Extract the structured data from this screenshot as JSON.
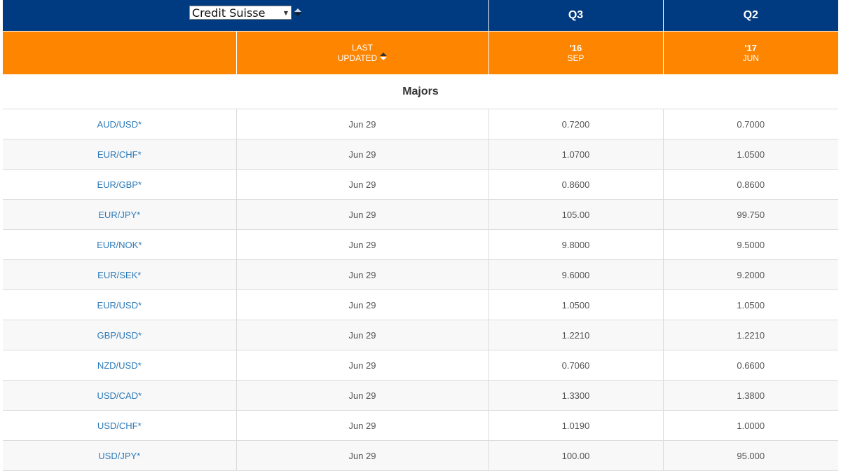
{
  "provider": {
    "selected": "Credit Suisse"
  },
  "columns": {
    "q3": "Q3",
    "q2": "Q2",
    "last_updated_line1": "LAST",
    "last_updated_line2": "UPDATED",
    "q3_year": "'16",
    "q3_month": "SEP",
    "q2_year": "'17",
    "q2_month": "JUN"
  },
  "section": {
    "title": "Majors"
  },
  "rows": [
    {
      "pair": "AUD/USD*",
      "updated": "Jun 29",
      "q3": "0.7200",
      "q2": "0.7000"
    },
    {
      "pair": "EUR/CHF*",
      "updated": "Jun 29",
      "q3": "1.0700",
      "q2": "1.0500"
    },
    {
      "pair": "EUR/GBP*",
      "updated": "Jun 29",
      "q3": "0.8600",
      "q2": "0.8600"
    },
    {
      "pair": "EUR/JPY*",
      "updated": "Jun 29",
      "q3": "105.00",
      "q2": "99.750"
    },
    {
      "pair": "EUR/NOK*",
      "updated": "Jun 29",
      "q3": "9.8000",
      "q2": "9.5000"
    },
    {
      "pair": "EUR/SEK*",
      "updated": "Jun 29",
      "q3": "9.6000",
      "q2": "9.2000"
    },
    {
      "pair": "EUR/USD*",
      "updated": "Jun 29",
      "q3": "1.0500",
      "q2": "1.0500"
    },
    {
      "pair": "GBP/USD*",
      "updated": "Jun 29",
      "q3": "1.2210",
      "q2": "1.2210"
    },
    {
      "pair": "NZD/USD*",
      "updated": "Jun 29",
      "q3": "0.7060",
      "q2": "0.6600"
    },
    {
      "pair": "USD/CAD*",
      "updated": "Jun 29",
      "q3": "1.3300",
      "q2": "1.3800"
    },
    {
      "pair": "USD/CHF*",
      "updated": "Jun 29",
      "q3": "1.0190",
      "q2": "1.0000"
    },
    {
      "pair": "USD/JPY*",
      "updated": "Jun 29",
      "q3": "100.00",
      "q2": "95.000"
    }
  ],
  "colors": {
    "header_blue": "#003a80",
    "header_orange": "#fe8500",
    "link_blue": "#2d7ab8"
  },
  "icons": {
    "sort": "sort-icon",
    "dropdown": "chevron-down-icon"
  }
}
